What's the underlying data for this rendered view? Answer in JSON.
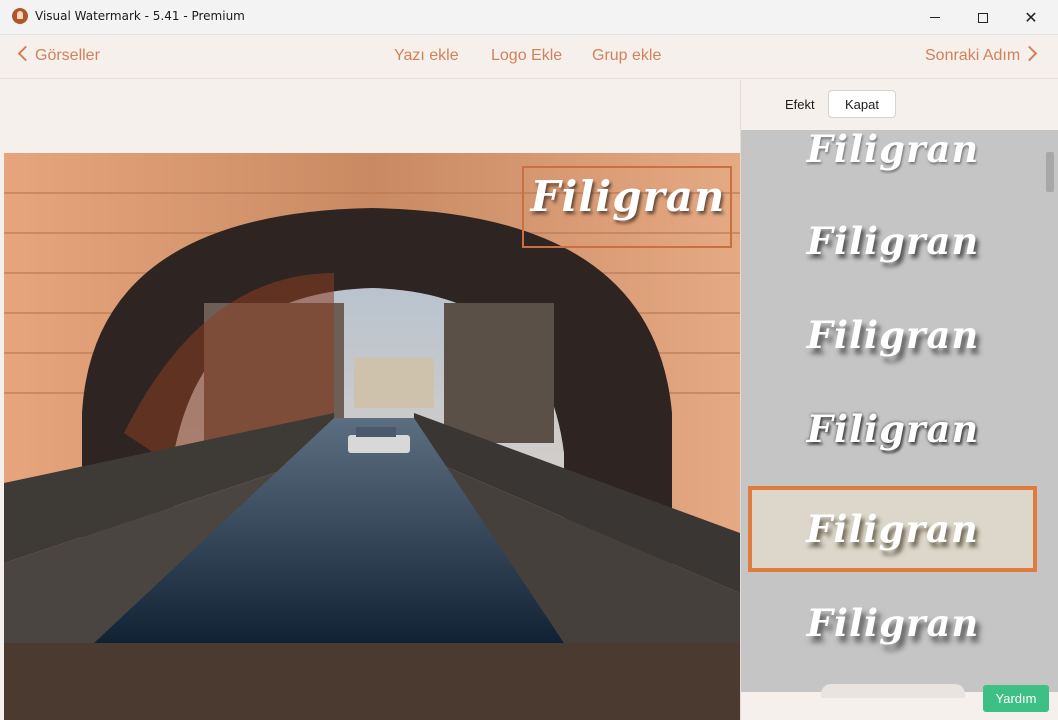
{
  "window": {
    "title": "Visual Watermark - 5.41 - Premium",
    "minimize_icon": "minimize-icon",
    "maximize_icon": "maximize-icon",
    "close_glyph": "✕"
  },
  "nav": {
    "back_label": "Görseller",
    "add_text_label": "Yazı ekle",
    "add_logo_label": "Logo Ekle",
    "add_group_label": "Grup ekle",
    "next_label": "Sonraki Adım"
  },
  "preview": {
    "watermark_text": "Filigran"
  },
  "panel": {
    "effect_label": "Efekt",
    "close_label": "Kapat",
    "effects": [
      {
        "text": "Filigran"
      },
      {
        "text": "Filigran"
      },
      {
        "text": "Filigran"
      },
      {
        "text": "Filigran"
      },
      {
        "text": "Filigran",
        "selected": true
      },
      {
        "text": "Filigran"
      }
    ],
    "help_label": "Yardım"
  },
  "colors": {
    "accent": "#d28158",
    "selection_border": "#e07b3e",
    "help_button": "#3dbf85",
    "panel_background": "#c5c5c5"
  }
}
